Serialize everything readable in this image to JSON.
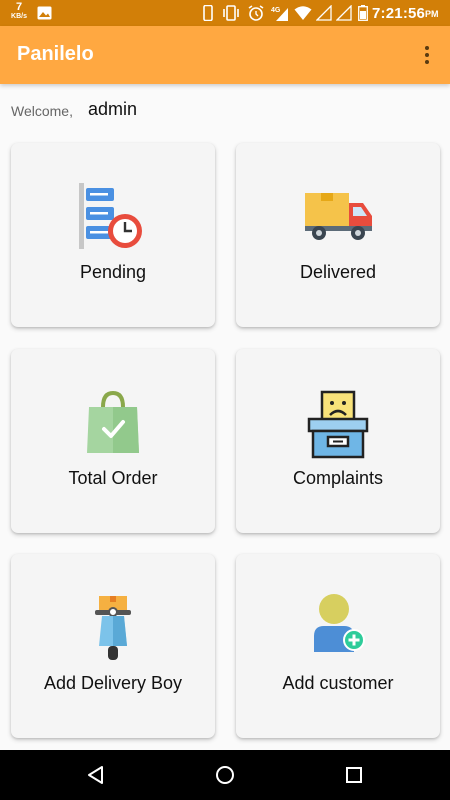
{
  "status_bar": {
    "speed_value": "7",
    "speed_unit": "KB/s",
    "time": "7:21:56",
    "ampm": "PM",
    "icons": [
      "image-icon",
      "phone-icon",
      "vibrate-icon",
      "alarm-icon",
      "4g-signal-icon",
      "wifi-icon",
      "signal-icon",
      "signal-icon",
      "battery-icon"
    ]
  },
  "app_bar": {
    "title": "Panilelo",
    "menu_icon": "more-vert-icon"
  },
  "welcome": {
    "label": "Welcome,",
    "username": "admin"
  },
  "cards": [
    {
      "label": "Pending",
      "icon": "pending-clock-list-icon"
    },
    {
      "label": "Delivered",
      "icon": "delivery-truck-icon"
    },
    {
      "label": "Total Order",
      "icon": "shopping-bag-icon"
    },
    {
      "label": "Complaints",
      "icon": "complaints-box-icon"
    },
    {
      "label": "Add Delivery Boy",
      "icon": "delivery-scooter-icon"
    },
    {
      "label": "Add customer",
      "icon": "add-user-icon"
    }
  ],
  "nav_bar": {
    "buttons": [
      "back-icon",
      "home-icon",
      "recents-icon"
    ]
  },
  "colors": {
    "status_bar": "#d27f08",
    "app_bar": "#ffa841",
    "background": "#fafafa",
    "card": "#f5f5f5"
  }
}
